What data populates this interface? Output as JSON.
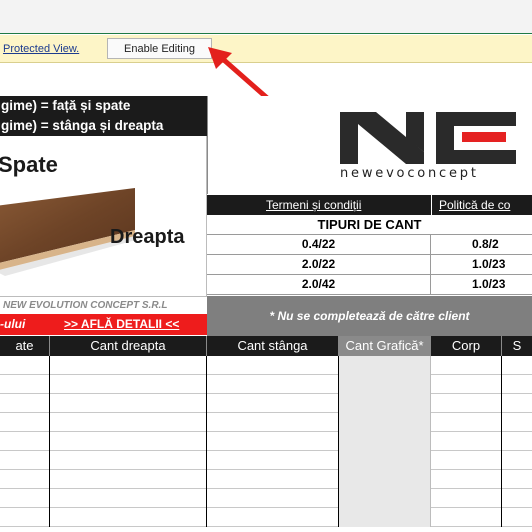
{
  "protected_view": {
    "link_text": "Protected View.",
    "button_label": "Enable Editing"
  },
  "banner": {
    "line1": "gime) = față și spate",
    "line2": "gime) = stânga și dreapta"
  },
  "product": {
    "label_back": "Spate",
    "label_right": "Dreapta"
  },
  "company": {
    "name": "NEW EVOLUTION CONCEPT S.R.L"
  },
  "red_bar": {
    "left_text": "-ului",
    "link_text": ">> AFLĂ DETALII <<"
  },
  "logo": {
    "text": "newevoconcept",
    "colors": {
      "dark": "#2a2a2a",
      "accent": "#e52222"
    }
  },
  "links": {
    "terms": "Termeni și condiții",
    "policy": "Politică de co"
  },
  "cant_types": {
    "title": "TIPURI DE CANT",
    "rows": [
      {
        "col1": "0.4/22",
        "col2": "0.8/2"
      },
      {
        "col1": "2.0/22",
        "col2": "1.0/23"
      },
      {
        "col1": "2.0/42",
        "col2": "1.0/23"
      }
    ]
  },
  "note": {
    "text": "* Nu se completează de către client"
  },
  "table_headers": [
    "ate",
    "Cant dreapta",
    "Cant stânga",
    "Cant Grafică*",
    "Corp",
    "S"
  ],
  "colors": {
    "excel_green": "#1f7a45",
    "protected_bar": "#fdf5c7",
    "header_dark": "#1b1b1b",
    "red_bar": "#ee1c1c",
    "note_grey": "#7f7f7f",
    "arrow_red": "#e3201c"
  }
}
